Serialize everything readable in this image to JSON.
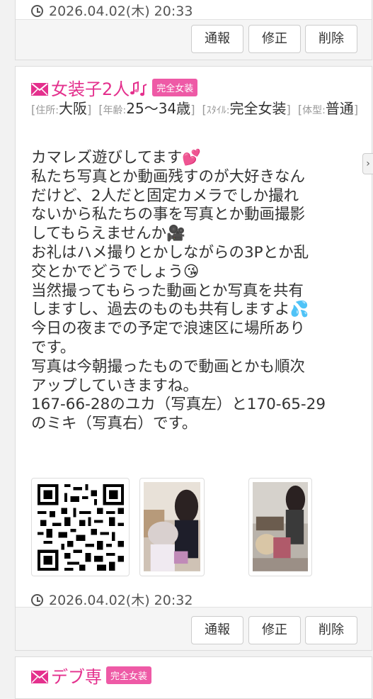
{
  "prev_post": {
    "timestamp": "2026.04.02(木) 20:33",
    "actions": {
      "report": "通報",
      "edit": "修正",
      "delete": "削除"
    }
  },
  "post": {
    "title": "女装子2人",
    "badge": "完全女装",
    "attributes": [
      {
        "key": "住所:",
        "value": "大阪"
      },
      {
        "key": "年齢:",
        "value": "25〜34歳"
      },
      {
        "key": "ｽﾀｲﾙ:",
        "value": "完全女装"
      },
      {
        "key": "体型:",
        "value": "普通"
      }
    ],
    "body_lines": [
      "カマレズ遊びしてます💕",
      "私たち写真とか動画残すのが大好きなん",
      "だけど、2人だと固定カメラでしか撮れ",
      "ないから私たちの事を写真とか動画撮影",
      "してもらえませんか🎥",
      "お礼はハメ撮りとかしながらの3Pとか乱",
      "交とかでどうでしょう😘",
      "当然撮ってもらった動画とか写真を共有",
      "しますし、過去のものも共有しますよ💦",
      "今日の夜までの予定で浪速区に場所あり",
      "です。",
      "写真は今朝撮ったもので動画とかも順次",
      "アップしていきますね。",
      "167-66-28のユカ（写真左）と170-65-29",
      "のミキ（写真右）です。"
    ],
    "timestamp": "2026.04.02(木) 20:32",
    "actions": {
      "report": "通報",
      "edit": "修正",
      "delete": "削除"
    }
  },
  "next_post": {
    "title": "デブ専",
    "badge": "完全女装"
  },
  "side_tab_icon": "chevron-right-icon",
  "colors": {
    "accent_pink": "#e4308d",
    "badge_pink": "#ee5aa6"
  }
}
